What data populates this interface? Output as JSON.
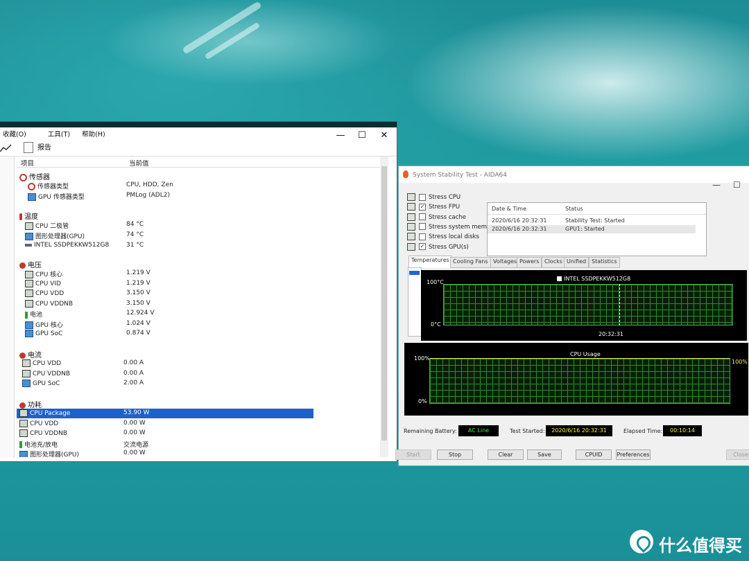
{
  "colors": {
    "accent": "#1e62c9",
    "selection": "#1e62c9",
    "chart_grid": "#2f8a2f",
    "chart_line": "#e8e85a",
    "box_green": "#3bf03b",
    "box_yellow": "#f6f64a"
  },
  "left_window": {
    "menu": [
      "收藏(O)",
      "工具(T)",
      "帮助(H)"
    ],
    "window_controls": [
      "—",
      "☐",
      "✕"
    ],
    "toolbar": {
      "report": "报告"
    },
    "header": {
      "col1": "项目",
      "col2": "当前值"
    },
    "groups": [
      {
        "title": "传感器",
        "icon": "sensor-icon",
        "rows": [
          {
            "label": "传感器类型",
            "value": "CPU, HDD, Zen",
            "icon": "sensor-icon"
          },
          {
            "label": "GPU 传感器类型",
            "value": "PMLog  (ADL2)",
            "icon": "monitor-icon"
          }
        ]
      },
      {
        "title": "温度",
        "icon": "thermometer-icon",
        "rows": [
          {
            "label": "CPU 二极管",
            "value": "84 °C",
            "icon": "chip-icon"
          },
          {
            "label": "图形处理器(GPU)",
            "value": "74 °C",
            "icon": "monitor-icon"
          },
          {
            "label": "INTEL SSDPEKKW512G8",
            "value": "31 °C",
            "icon": "disk-icon"
          }
        ]
      },
      {
        "title": "电压",
        "icon": "voltage-icon",
        "rows": [
          {
            "label": "CPU 核心",
            "value": "1.219 V",
            "icon": "chip-icon"
          },
          {
            "label": "CPU VID",
            "value": "1.219 V",
            "icon": "chip-icon"
          },
          {
            "label": "CPU VDD",
            "value": "3.150 V",
            "icon": "chip-icon"
          },
          {
            "label": "CPU VDDNB",
            "value": "3.150 V",
            "icon": "chip-icon"
          },
          {
            "label": "电池",
            "value": "12.924 V",
            "icon": "battery-icon"
          },
          {
            "label": "GPU 核心",
            "value": "1.024 V",
            "icon": "monitor-icon"
          },
          {
            "label": "GPU SoC",
            "value": "0.874 V",
            "icon": "monitor-icon"
          }
        ]
      },
      {
        "title": "电流",
        "icon": "voltage-icon",
        "rows": [
          {
            "label": "CPU VDD",
            "value": "0.00 A",
            "icon": "chip-icon"
          },
          {
            "label": "CPU VDDNB",
            "value": "0.00 A",
            "icon": "chip-icon"
          },
          {
            "label": "GPU SoC",
            "value": "2.00 A",
            "icon": "monitor-icon"
          }
        ]
      },
      {
        "title": "功耗",
        "icon": "voltage-icon",
        "rows": [
          {
            "label": "CPU Package",
            "value": "53.90 W",
            "icon": "chip-icon",
            "selected": true
          },
          {
            "label": "CPU VDD",
            "value": "0.00 W",
            "icon": "chip-icon"
          },
          {
            "label": "CPU VDDNB",
            "value": "0.00 W",
            "icon": "chip-icon"
          },
          {
            "label": "电池充/放电",
            "value": "交流电源",
            "icon": "battery-icon"
          },
          {
            "label": "图形处理器(GPU)",
            "value": "0.00 W",
            "icon": "monitor-icon"
          }
        ]
      }
    ]
  },
  "aida": {
    "title": "System Stability Test - AIDA64",
    "window_controls": [
      "—",
      "☐"
    ],
    "stress_options": [
      {
        "label": "Stress CPU",
        "checked": false
      },
      {
        "label": "Stress FPU",
        "checked": true
      },
      {
        "label": "Stress cache",
        "checked": false
      },
      {
        "label": "Stress system memory",
        "checked": false
      },
      {
        "label": "Stress local disks",
        "checked": false
      },
      {
        "label": "Stress GPU(s)",
        "checked": true
      }
    ],
    "log_headers": {
      "date": "Date & Time",
      "status": "Status"
    },
    "log_rows": [
      {
        "date": "2020/6/16 20:32:31",
        "status": "Stability Test: Started"
      },
      {
        "date": "2020/6/16 20:32:31",
        "status": "GPU1: Started"
      }
    ],
    "tabs": [
      "Temperatures",
      "Cooling Fans",
      "Voltages",
      "Powers",
      "Clocks",
      "Unified",
      "Statistics"
    ],
    "temp_chart": {
      "legend": "INTEL SSDPEKKW512G8",
      "ymax": "100°C",
      "ymin": "0°C",
      "time": "20:32:31"
    },
    "cpu_chart": {
      "title": "CPU Usage",
      "ymax": "100%",
      "ymin": "0%",
      "current": "100%"
    },
    "status": {
      "battery_label": "Remaining Battery:",
      "battery_value": "AC Line",
      "started_label": "Test Started:",
      "started_value": "2020/6/16 20:32:31",
      "elapsed_label": "Elapsed Time:",
      "elapsed_value": "00:10:14"
    },
    "buttons": {
      "start": "Start",
      "stop": "Stop",
      "clear": "Clear",
      "save": "Save",
      "cpuid": "CPUID",
      "preferences": "Preferences",
      "close": "Close"
    }
  },
  "watermark": "什么值得买"
}
